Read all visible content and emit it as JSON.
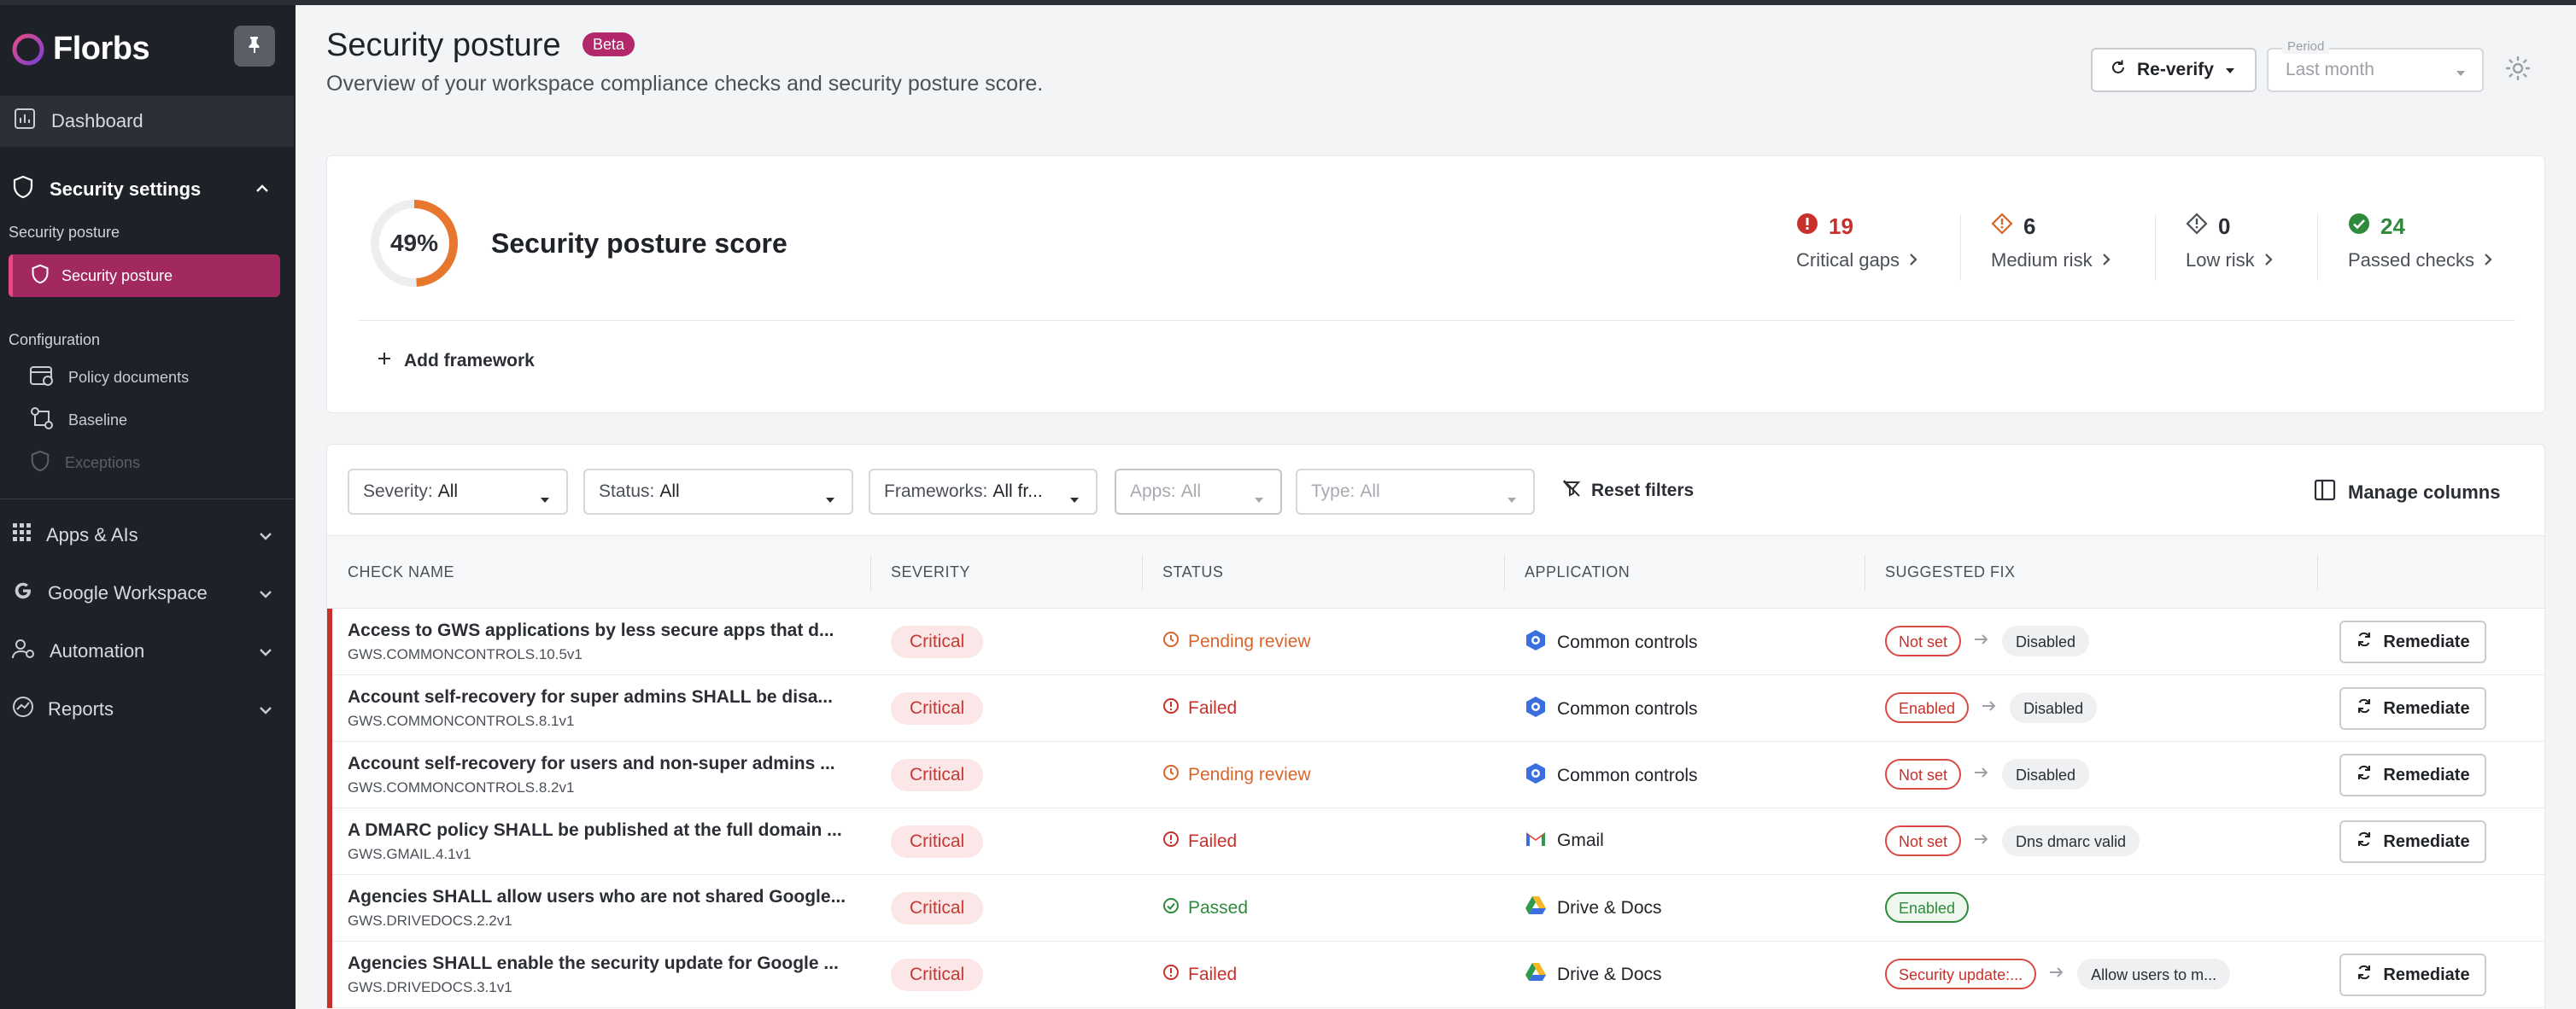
{
  "app": {
    "name": "Florbs"
  },
  "sidebar": {
    "dashboard": "Dashboard",
    "security_settings": "Security settings",
    "group_security_posture": "Security posture",
    "active_item": "Security posture",
    "group_configuration": "Configuration",
    "config_items": [
      "Policy documents",
      "Baseline",
      "Exceptions"
    ],
    "main_items": [
      "Apps & AIs",
      "Google Workspace",
      "Automation",
      "Reports"
    ]
  },
  "header": {
    "title": "Security posture",
    "badge": "Beta",
    "subtitle": "Overview of your workspace compliance checks and security posture score.",
    "reverify": "Re-verify",
    "period_label": "Period",
    "period_value": "Last month"
  },
  "score": {
    "percent_label": "49%",
    "percent": 49,
    "title": "Security posture score",
    "metrics": [
      {
        "value": "19",
        "label": "Critical gaps"
      },
      {
        "value": "6",
        "label": "Medium risk"
      },
      {
        "value": "0",
        "label": "Low risk"
      },
      {
        "value": "24",
        "label": "Passed checks"
      }
    ],
    "add_framework": "Add framework"
  },
  "filters": {
    "severity": {
      "label": "Severity:",
      "value": "All"
    },
    "status": {
      "label": "Status:",
      "value": "All"
    },
    "frameworks": {
      "label": "Frameworks:",
      "value": "All fr..."
    },
    "apps": {
      "label": "Apps:",
      "value": "All"
    },
    "type": {
      "label": "Type:",
      "value": "All"
    },
    "reset": "Reset filters",
    "manage_columns": "Manage columns"
  },
  "table": {
    "columns": [
      "CHECK NAME",
      "SEVERITY",
      "STATUS",
      "APPLICATION",
      "SUGGESTED FIX"
    ],
    "remediate_label": "Remediate",
    "rows": [
      {
        "name": "Access to GWS applications by less secure apps that d...",
        "code": "GWS.COMMONCONTROLS.10.5v1",
        "severity": "Critical",
        "status": "Pending review",
        "app": "Common controls",
        "fix_from": "Not set",
        "fix_to": "Disabled"
      },
      {
        "name": "Account self-recovery for super admins SHALL be disa...",
        "code": "GWS.COMMONCONTROLS.8.1v1",
        "severity": "Critical",
        "status": "Failed",
        "app": "Common controls",
        "fix_from": "Enabled",
        "fix_to": "Disabled"
      },
      {
        "name": "Account self-recovery for users and non-super admins ...",
        "code": "GWS.COMMONCONTROLS.8.2v1",
        "severity": "Critical",
        "status": "Pending review",
        "app": "Common controls",
        "fix_from": "Not set",
        "fix_to": "Disabled"
      },
      {
        "name": "A DMARC policy SHALL be published at the full domain ...",
        "code": "GWS.GMAIL.4.1v1",
        "severity": "Critical",
        "status": "Failed",
        "app": "Gmail",
        "fix_from": "Not set",
        "fix_to": "Dns dmarc valid"
      },
      {
        "name": "Agencies SHALL allow users who are not shared Google...",
        "code": "GWS.DRIVEDOCS.2.2v1",
        "severity": "Critical",
        "status": "Passed",
        "app": "Drive & Docs",
        "fix_from": "Enabled",
        "fix_to": ""
      },
      {
        "name": "Agencies SHALL enable the security update for Google ...",
        "code": "GWS.DRIVEDOCS.3.1v1",
        "severity": "Critical",
        "status": "Failed",
        "app": "Drive & Docs",
        "fix_from": "Security update:...",
        "fix_to": "Allow users to m..."
      }
    ]
  },
  "colors": {
    "accent": "#a2295f",
    "critical": "#c8312b",
    "pending": "#d8652a",
    "passed": "#2f8a3c",
    "sidebar": "#1e2127"
  }
}
